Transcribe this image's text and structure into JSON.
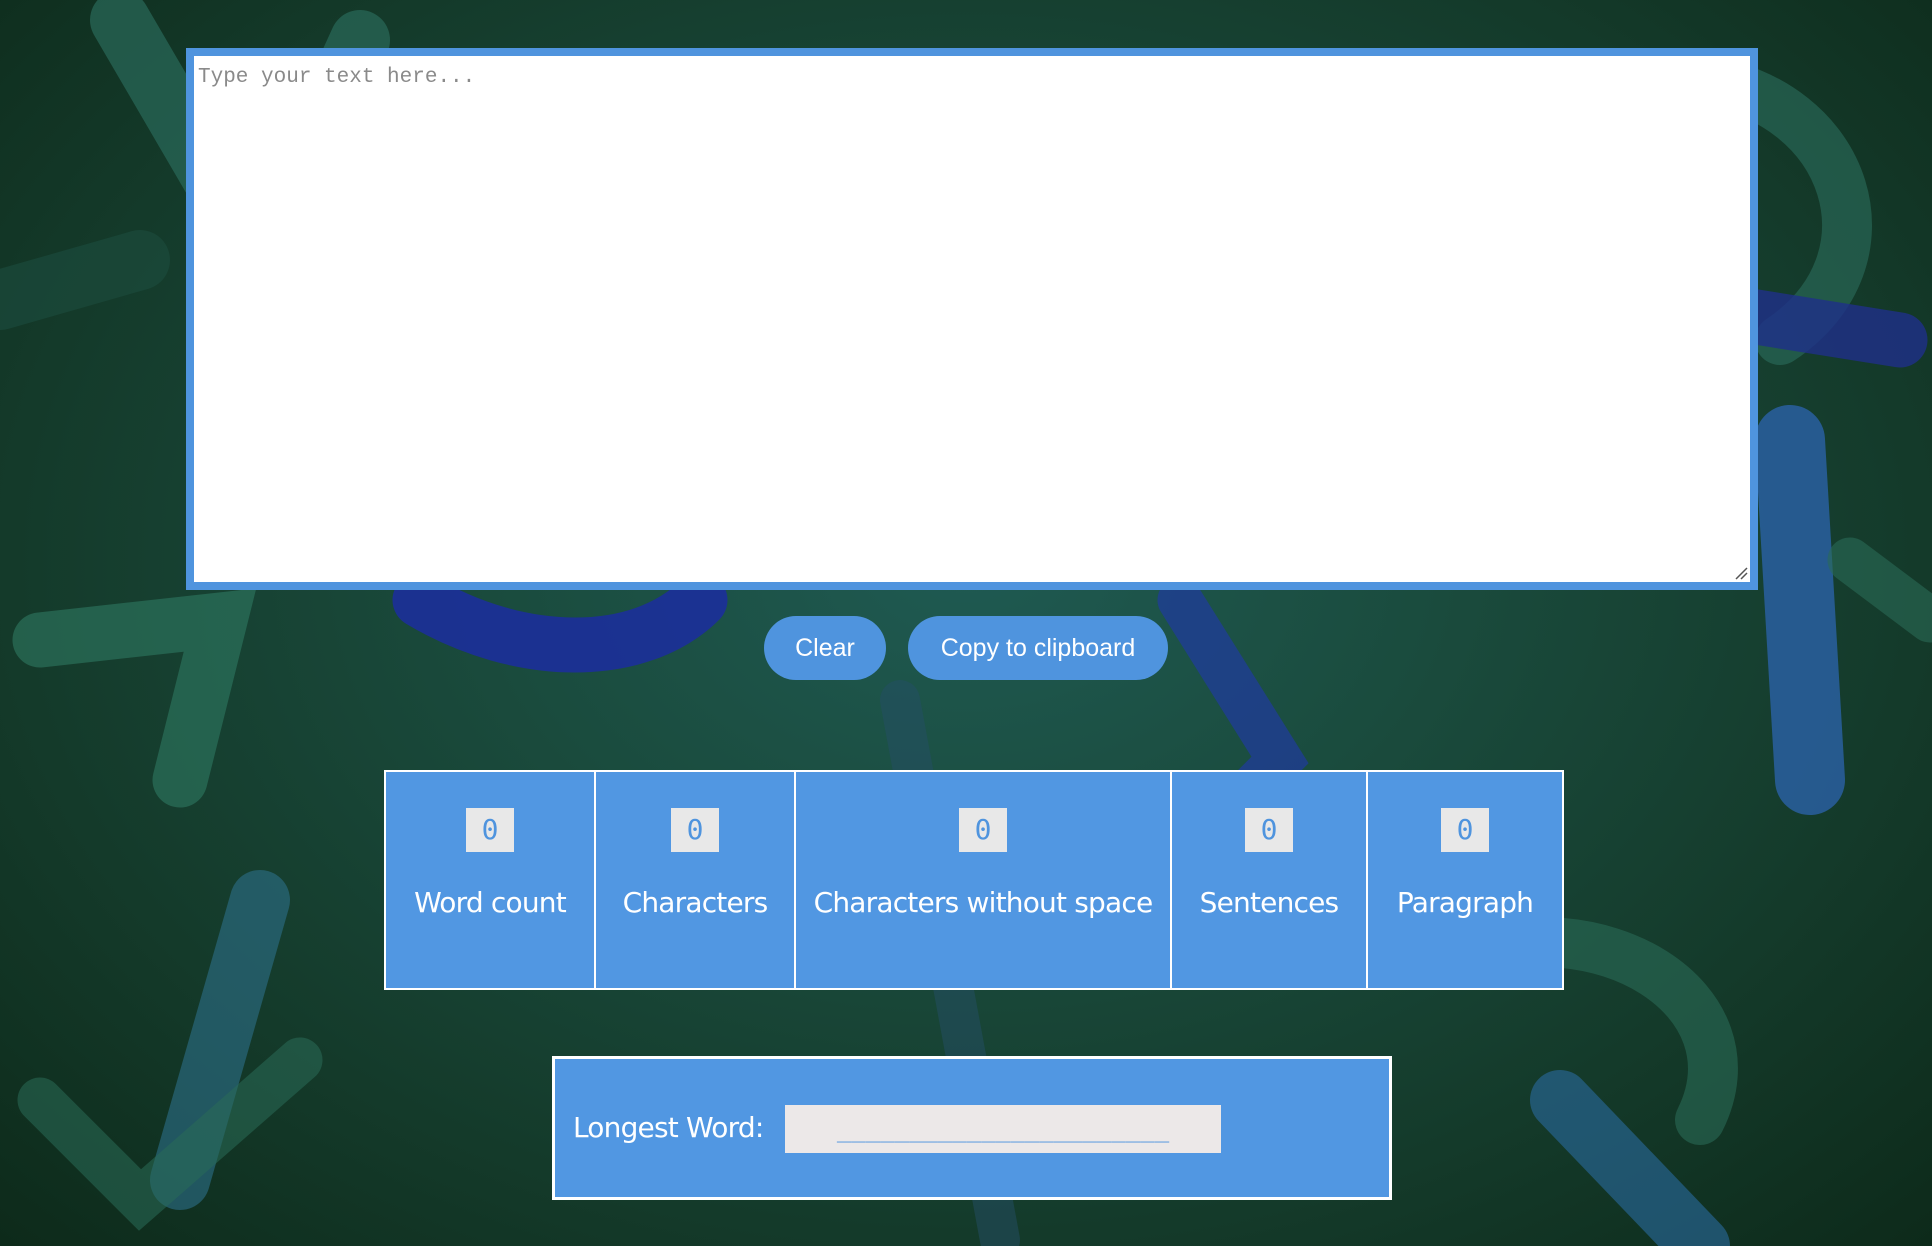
{
  "editor": {
    "placeholder": "Type your text here...",
    "value": ""
  },
  "buttons": {
    "clear_label": "Clear",
    "copy_label": "Copy to clipboard"
  },
  "stats": [
    {
      "label": "Word count",
      "value": "0"
    },
    {
      "label": "Characters",
      "value": "0"
    },
    {
      "label": "Characters without space",
      "value": "0"
    },
    {
      "label": "Sentences",
      "value": "0"
    },
    {
      "label": "Paragraph",
      "value": "0"
    }
  ],
  "longest_word": {
    "label": "Longest Word:",
    "value": "_______________________"
  },
  "colors": {
    "accent": "#4f94de",
    "panel": "#5197e2",
    "value_bg": "#e8e8e8",
    "text_on_accent": "#ffffff"
  }
}
